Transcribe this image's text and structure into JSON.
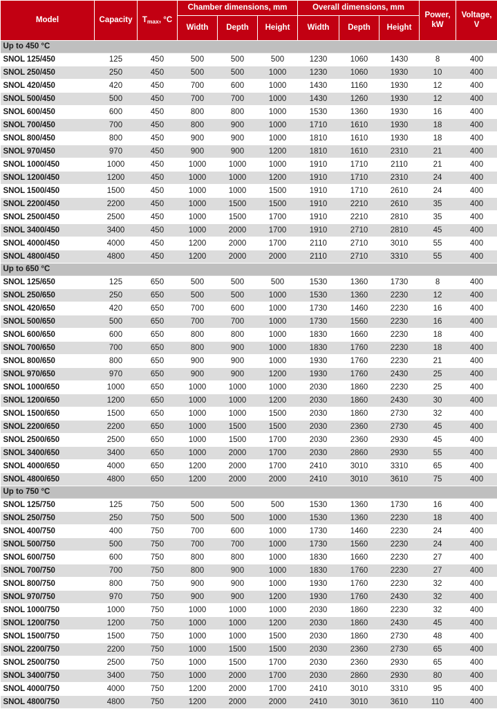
{
  "table": {
    "columns": {
      "model": "Model",
      "capacity": "Capacity",
      "tmax_main": "T",
      "tmax_sub": "max",
      "tmax_tail": ", °C",
      "chamber_group": "Chamber dimensions, mm",
      "overall_group": "Overall dimensions, mm",
      "chamber_width": "Width",
      "chamber_depth": "Depth",
      "chamber_height": "Height",
      "overall_width": "Width",
      "overall_depth": "Depth",
      "overall_height": "Height",
      "power": "Power, kW",
      "power_line1": "Power,",
      "power_line2": "kW",
      "voltage": "Voltage, V",
      "voltage_line1": "Voltage,",
      "voltage_line2": "V"
    },
    "colors": {
      "header_red": "#C20012",
      "section_gray": "#BFBFBF",
      "stripe_gray": "#DCDCDC",
      "text": "#1A1A1A",
      "header_text": "#FFFFFF"
    },
    "sections": [
      {
        "title": "Up to 450 °C",
        "rows": [
          [
            "SNOL 125/450",
            "125",
            "450",
            "500",
            "500",
            "500",
            "1230",
            "1060",
            "1430",
            "8",
            "400"
          ],
          [
            "SNOL 250/450",
            "250",
            "450",
            "500",
            "500",
            "1000",
            "1230",
            "1060",
            "1930",
            "10",
            "400"
          ],
          [
            "SNOL 420/450",
            "420",
            "450",
            "700",
            "600",
            "1000",
            "1430",
            "1160",
            "1930",
            "12",
            "400"
          ],
          [
            "SNOL 500/450",
            "500",
            "450",
            "700",
            "700",
            "1000",
            "1430",
            "1260",
            "1930",
            "12",
            "400"
          ],
          [
            "SNOL 600/450",
            "600",
            "450",
            "800",
            "800",
            "1000",
            "1530",
            "1360",
            "1930",
            "16",
            "400"
          ],
          [
            "SNOL 700/450",
            "700",
            "450",
            "800",
            "900",
            "1000",
            "1710",
            "1610",
            "1930",
            "18",
            "400"
          ],
          [
            "SNOL 800/450",
            "800",
            "450",
            "900",
            "900",
            "1000",
            "1810",
            "1610",
            "1930",
            "18",
            "400"
          ],
          [
            "SNOL 970/450",
            "970",
            "450",
            "900",
            "900",
            "1200",
            "1810",
            "1610",
            "2310",
            "21",
            "400"
          ],
          [
            "SNOL 1000/450",
            "1000",
            "450",
            "1000",
            "1000",
            "1000",
            "1910",
            "1710",
            "2110",
            "21",
            "400"
          ],
          [
            "SNOL 1200/450",
            "1200",
            "450",
            "1000",
            "1000",
            "1200",
            "1910",
            "1710",
            "2310",
            "24",
            "400"
          ],
          [
            "SNOL 1500/450",
            "1500",
            "450",
            "1000",
            "1000",
            "1500",
            "1910",
            "1710",
            "2610",
            "24",
            "400"
          ],
          [
            "SNOL 2200/450",
            "2200",
            "450",
            "1000",
            "1500",
            "1500",
            "1910",
            "2210",
            "2610",
            "35",
            "400"
          ],
          [
            "SNOL 2500/450",
            "2500",
            "450",
            "1000",
            "1500",
            "1700",
            "1910",
            "2210",
            "2810",
            "35",
            "400"
          ],
          [
            "SNOL 3400/450",
            "3400",
            "450",
            "1000",
            "2000",
            "1700",
            "1910",
            "2710",
            "2810",
            "45",
            "400"
          ],
          [
            "SNOL 4000/450",
            "4000",
            "450",
            "1200",
            "2000",
            "1700",
            "2110",
            "2710",
            "3010",
            "55",
            "400"
          ],
          [
            "SNOL 4800/450",
            "4800",
            "450",
            "1200",
            "2000",
            "2000",
            "2110",
            "2710",
            "3310",
            "55",
            "400"
          ]
        ]
      },
      {
        "title": "Up to 650 °C",
        "rows": [
          [
            "SNOL 125/650",
            "125",
            "650",
            "500",
            "500",
            "500",
            "1530",
            "1360",
            "1730",
            "8",
            "400"
          ],
          [
            "SNOL 250/650",
            "250",
            "650",
            "500",
            "500",
            "1000",
            "1530",
            "1360",
            "2230",
            "12",
            "400"
          ],
          [
            "SNOL 420/650",
            "420",
            "650",
            "700",
            "600",
            "1000",
            "1730",
            "1460",
            "2230",
            "16",
            "400"
          ],
          [
            "SNOL 500/650",
            "500",
            "650",
            "700",
            "700",
            "1000",
            "1730",
            "1560",
            "2230",
            "16",
            "400"
          ],
          [
            "SNOL 600/650",
            "600",
            "650",
            "800",
            "800",
            "1000",
            "1830",
            "1660",
            "2230",
            "18",
            "400"
          ],
          [
            "SNOL 700/650",
            "700",
            "650",
            "800",
            "900",
            "1000",
            "1830",
            "1760",
            "2230",
            "18",
            "400"
          ],
          [
            "SNOL 800/650",
            "800",
            "650",
            "900",
            "900",
            "1000",
            "1930",
            "1760",
            "2230",
            "21",
            "400"
          ],
          [
            "SNOL 970/650",
            "970",
            "650",
            "900",
            "900",
            "1200",
            "1930",
            "1760",
            "2430",
            "25",
            "400"
          ],
          [
            "SNOL 1000/650",
            "1000",
            "650",
            "1000",
            "1000",
            "1000",
            "2030",
            "1860",
            "2230",
            "25",
            "400"
          ],
          [
            "SNOL 1200/650",
            "1200",
            "650",
            "1000",
            "1000",
            "1200",
            "2030",
            "1860",
            "2430",
            "30",
            "400"
          ],
          [
            "SNOL 1500/650",
            "1500",
            "650",
            "1000",
            "1000",
            "1500",
            "2030",
            "1860",
            "2730",
            "32",
            "400"
          ],
          [
            "SNOL 2200/650",
            "2200",
            "650",
            "1000",
            "1500",
            "1500",
            "2030",
            "2360",
            "2730",
            "45",
            "400"
          ],
          [
            "SNOL 2500/650",
            "2500",
            "650",
            "1000",
            "1500",
            "1700",
            "2030",
            "2360",
            "2930",
            "45",
            "400"
          ],
          [
            "SNOL 3400/650",
            "3400",
            "650",
            "1000",
            "2000",
            "1700",
            "2030",
            "2860",
            "2930",
            "55",
            "400"
          ],
          [
            "SNOL 4000/650",
            "4000",
            "650",
            "1200",
            "2000",
            "1700",
            "2410",
            "3010",
            "3310",
            "65",
            "400"
          ],
          [
            "SNOL 4800/650",
            "4800",
            "650",
            "1200",
            "2000",
            "2000",
            "2410",
            "3010",
            "3610",
            "75",
            "400"
          ]
        ]
      },
      {
        "title": "Up to 750 °C",
        "rows": [
          [
            "SNOL 125/750",
            "125",
            "750",
            "500",
            "500",
            "500",
            "1530",
            "1360",
            "1730",
            "16",
            "400"
          ],
          [
            "SNOL 250/750",
            "250",
            "750",
            "500",
            "500",
            "1000",
            "1530",
            "1360",
            "2230",
            "18",
            "400"
          ],
          [
            "SNOL 400/750",
            "400",
            "750",
            "700",
            "600",
            "1000",
            "1730",
            "1460",
            "2230",
            "24",
            "400"
          ],
          [
            "SNOL 500/750",
            "500",
            "750",
            "700",
            "700",
            "1000",
            "1730",
            "1560",
            "2230",
            "24",
            "400"
          ],
          [
            "SNOL 600/750",
            "600",
            "750",
            "800",
            "800",
            "1000",
            "1830",
            "1660",
            "2230",
            "27",
            "400"
          ],
          [
            "SNOL 700/750",
            "700",
            "750",
            "800",
            "900",
            "1000",
            "1830",
            "1760",
            "2230",
            "27",
            "400"
          ],
          [
            "SNOL 800/750",
            "800",
            "750",
            "900",
            "900",
            "1000",
            "1930",
            "1760",
            "2230",
            "32",
            "400"
          ],
          [
            "SNOL 970/750",
            "970",
            "750",
            "900",
            "900",
            "1200",
            "1930",
            "1760",
            "2430",
            "32",
            "400"
          ],
          [
            "SNOL 1000/750",
            "1000",
            "750",
            "1000",
            "1000",
            "1000",
            "2030",
            "1860",
            "2230",
            "32",
            "400"
          ],
          [
            "SNOL 1200/750",
            "1200",
            "750",
            "1000",
            "1000",
            "1200",
            "2030",
            "1860",
            "2430",
            "45",
            "400"
          ],
          [
            "SNOL 1500/750",
            "1500",
            "750",
            "1000",
            "1000",
            "1500",
            "2030",
            "1860",
            "2730",
            "48",
            "400"
          ],
          [
            "SNOL 2200/750",
            "2200",
            "750",
            "1000",
            "1500",
            "1500",
            "2030",
            "2360",
            "2730",
            "65",
            "400"
          ],
          [
            "SNOL 2500/750",
            "2500",
            "750",
            "1000",
            "1500",
            "1700",
            "2030",
            "2360",
            "2930",
            "65",
            "400"
          ],
          [
            "SNOL 3400/750",
            "3400",
            "750",
            "1000",
            "2000",
            "1700",
            "2030",
            "2860",
            "2930",
            "80",
            "400"
          ],
          [
            "SNOL 4000/750",
            "4000",
            "750",
            "1200",
            "2000",
            "1700",
            "2410",
            "3010",
            "3310",
            "95",
            "400"
          ],
          [
            "SNOL 4800/750",
            "4800",
            "750",
            "1200",
            "2000",
            "2000",
            "2410",
            "3010",
            "3610",
            "110",
            "400"
          ]
        ]
      }
    ]
  }
}
